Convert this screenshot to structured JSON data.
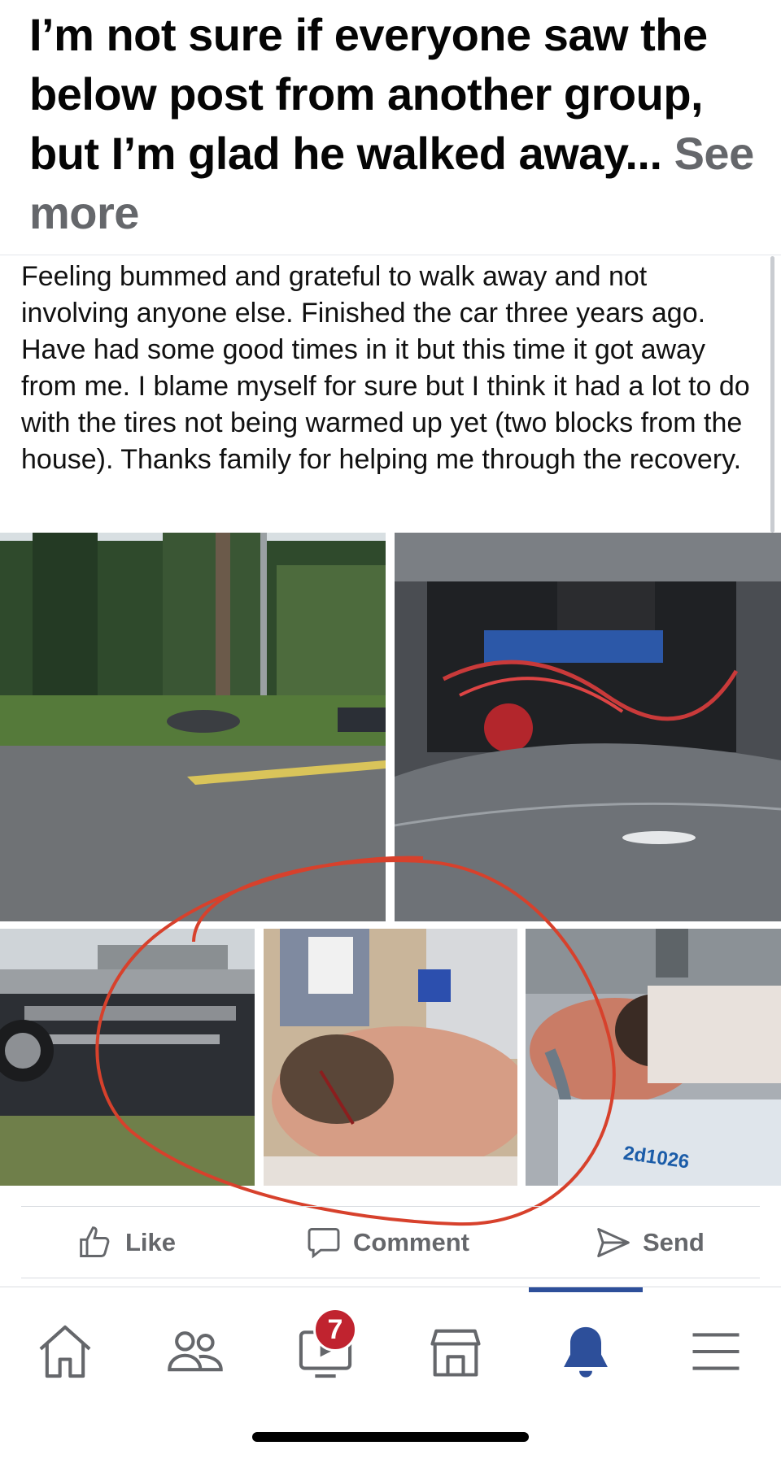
{
  "post": {
    "header_text": "I’m not sure if everyone saw the below post from another group, but I’m glad he walked away...",
    "see_more_label": "See more"
  },
  "shared_post": {
    "body": "Feeling bummed and grateful to walk away and not involving anyone else. Finished the car three years ago. Have had some good times in it but this time it got away from me. I blame myself for sure but I think it had a lot to do with the tires not being warmed up yet (two blocks from the house). Thanks family for helping me through the recovery."
  },
  "photos": [
    {
      "id": "crash-scene-road",
      "icon": "photo-icon"
    },
    {
      "id": "engine-bay",
      "icon": "photo-icon"
    },
    {
      "id": "overturned-car",
      "icon": "photo-icon"
    },
    {
      "id": "head-injury",
      "icon": "photo-icon"
    },
    {
      "id": "hospital-bed",
      "icon": "photo-icon",
      "overlay_text": "2d1026"
    }
  ],
  "annotation": {
    "color": "#d7412c",
    "shape": "hand-drawn circle"
  },
  "actions": {
    "like_label": "Like",
    "comment_label": "Comment",
    "send_label": "Send"
  },
  "tabbar": {
    "items": [
      {
        "name": "home",
        "icon": "home-icon"
      },
      {
        "name": "friends",
        "icon": "friends-icon"
      },
      {
        "name": "watch",
        "icon": "video-icon",
        "badge": "7"
      },
      {
        "name": "marketplace",
        "icon": "marketplace-icon"
      },
      {
        "name": "notifications",
        "icon": "bell-icon",
        "active": true
      },
      {
        "name": "menu",
        "icon": "menu-icon"
      }
    ],
    "active_color": "#2d4f9a",
    "badge_color": "#c0232f"
  }
}
